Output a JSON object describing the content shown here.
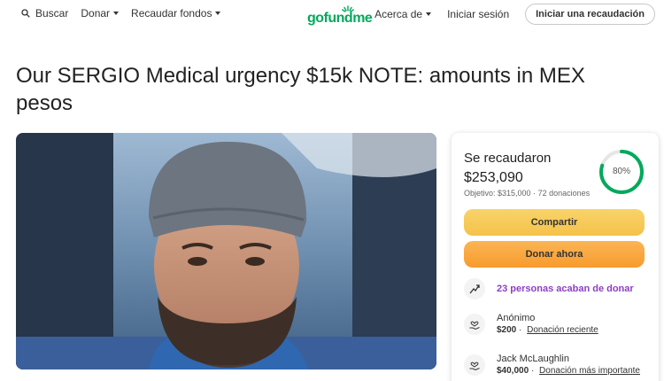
{
  "header": {
    "search_label": "Buscar",
    "donate_label": "Donar",
    "fundraise_label": "Recaudar fondos",
    "logo_text": "gofundme",
    "about_label": "Acerca de",
    "login_label": "Iniciar sesión",
    "start_label": "Iniciar una recaudación",
    "brand_color": "#02a95c"
  },
  "campaign": {
    "title": "Our SERGIO Medical urgency $15k NOTE: amounts in MEX pesos"
  },
  "donation_card": {
    "raised_label": "Se recaudaron",
    "raised_amount": "$253,090",
    "goal_text": "Objetivo: $315,000",
    "donations_text": "72 donaciones",
    "progress_percent": 80,
    "progress_label": "80%",
    "share_label": "Compartir",
    "donate_label": "Donar ahora",
    "recent_activity_text": "23 personas acaban de donar",
    "donors": [
      {
        "name": "Anónimo",
        "amount": "$200",
        "tag": "Donación reciente"
      },
      {
        "name": "Jack McLaughlin",
        "amount": "$40,000",
        "tag": "Donación más importante"
      }
    ]
  }
}
